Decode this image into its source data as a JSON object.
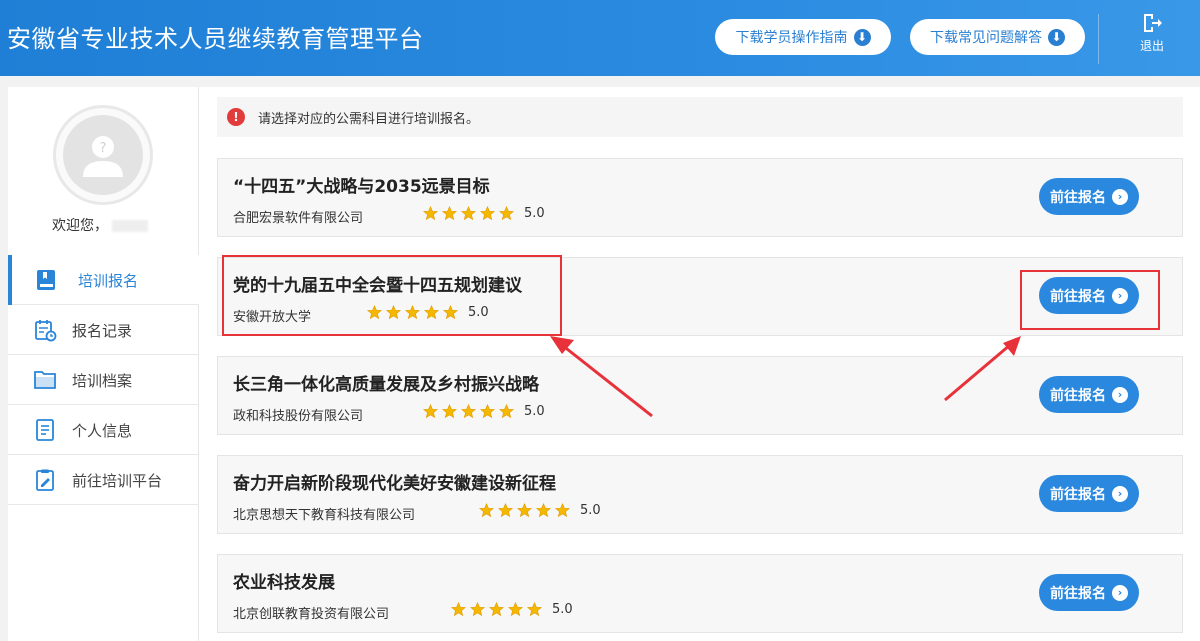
{
  "header": {
    "title": "安徽省专业技术人员继续教育管理平台",
    "guide_button": "下载学员操作指南",
    "faq_button": "下载常见问题解答",
    "logout_label": "退出"
  },
  "sidebar": {
    "welcome": "欢迎您，",
    "items": [
      {
        "label": "培训报名",
        "icon": "book-icon",
        "active": true
      },
      {
        "label": "报名记录",
        "icon": "calendar-record-icon",
        "active": false
      },
      {
        "label": "培训档案",
        "icon": "folder-icon",
        "active": false
      },
      {
        "label": "个人信息",
        "icon": "document-icon",
        "active": false
      },
      {
        "label": "前往培训平台",
        "icon": "clipboard-edit-icon",
        "active": false
      }
    ]
  },
  "main": {
    "notice": "请选择对应的公需科目进行培训报名。",
    "courses": [
      {
        "title": "“十四五”大战略与2035远景目标",
        "org": "合肥宏景软件有限公司",
        "score": "5.0",
        "rating": 5,
        "button": "前往报名"
      },
      {
        "title": "党的十九届五中全会暨十四五规划建议",
        "org": "安徽开放大学",
        "score": "5.0",
        "rating": 5,
        "button": "前往报名"
      },
      {
        "title": "长三角一体化高质量发展及乡村振兴战略",
        "org": "政和科技股份有限公司",
        "score": "5.0",
        "rating": 5,
        "button": "前往报名"
      },
      {
        "title": "奋力开启新阶段现代化美好安徽建设新征程",
        "org": "北京思想天下教育科技有限公司",
        "score": "5.0",
        "rating": 5,
        "button": "前往报名"
      },
      {
        "title": "农业科技发展",
        "org": "北京创联教育投资有限公司",
        "score": "5.0",
        "rating": 5,
        "button": "前往报名"
      }
    ]
  },
  "colors": {
    "header": "#2a8be0",
    "accent": "#2a88de",
    "annotation": "#e8323a",
    "star": "#f5b800"
  }
}
